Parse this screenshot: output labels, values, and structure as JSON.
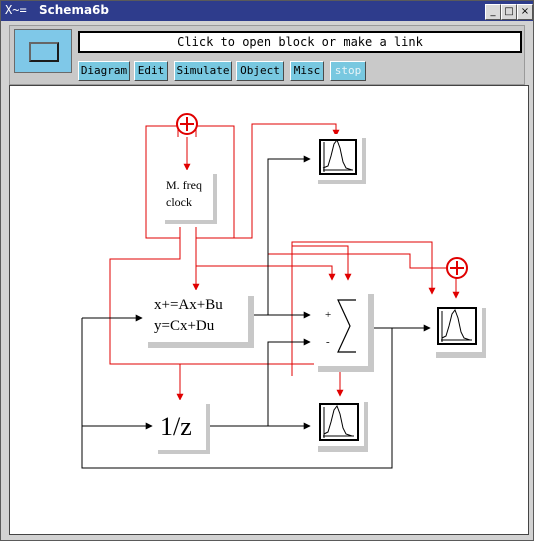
{
  "window": {
    "title": "Schema6b",
    "title_icon": "X~="
  },
  "message_bar": {
    "text": "Click to open block or make a link"
  },
  "menu": [
    {
      "label": "Diagram"
    },
    {
      "label": "Edit"
    },
    {
      "label": "Simulate"
    },
    {
      "label": "Object"
    },
    {
      "label": "Misc"
    },
    {
      "label": "stop"
    }
  ],
  "blocks": {
    "clock": {
      "line1": "M. freq",
      "line2": "clock"
    },
    "statespace": {
      "line1": "x+=Ax+Bu",
      "line2": "y=Cx+Du"
    },
    "delay": {
      "label": "1/z"
    },
    "sum": {
      "plus": "+",
      "minus": "-"
    }
  },
  "colors": {
    "link_event": "#e00000",
    "link_regular": "#000000",
    "block_shadow": "#c8c8c8",
    "title_bar": "#2e3c8c",
    "menu_button": "#78c8e0"
  }
}
